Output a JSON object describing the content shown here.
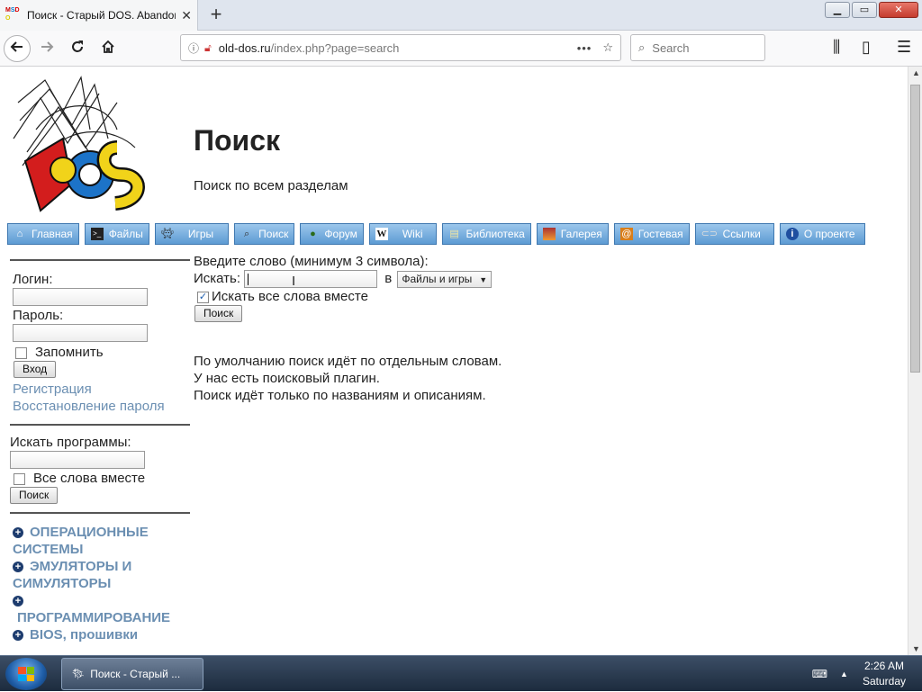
{
  "browser": {
    "tab_title": "Поиск - Старый DOS. Abandon",
    "new_tab": "+",
    "url_host": "old-dos.ru",
    "url_path": "/index.php?page=search",
    "search_placeholder": "Search",
    "window_controls": {
      "minimize": "▁",
      "maximize": "▭",
      "close": "✕"
    }
  },
  "page": {
    "title": "Поиск",
    "subtitle": "Поиск по всем разделам"
  },
  "menu": [
    {
      "label": "Главная",
      "icon": "home-icon"
    },
    {
      "label": "Файлы",
      "icon": "terminal-icon"
    },
    {
      "label": "Игры",
      "icon": "invader-icon"
    },
    {
      "label": "Поиск",
      "icon": "magnifier-icon"
    },
    {
      "label": "Форум",
      "icon": "person-icon"
    },
    {
      "label": "Wiki",
      "icon": "wiki-icon"
    },
    {
      "label": "Библиотека",
      "icon": "book-icon"
    },
    {
      "label": "Галерея",
      "icon": "picture-icon"
    },
    {
      "label": "Гостевая",
      "icon": "guestbook-icon"
    },
    {
      "label": "Ссылки",
      "icon": "link-icon"
    },
    {
      "label": "О проекте",
      "icon": "info-icon"
    }
  ],
  "login": {
    "login_label": "Логин:",
    "password_label": "Пароль:",
    "remember_label": "Запомнить",
    "submit_label": "Вход",
    "register_link": "Регистрация",
    "recover_link": "Восстановление пароля"
  },
  "side_search": {
    "label": "Искать программы:",
    "all_words_label": "Все слова вместе",
    "submit_label": "Поиск"
  },
  "categories": [
    "ОПЕРАЦИОННЫЕ СИСТЕМЫ",
    "ЭМУЛЯТОРЫ И СИМУЛЯТОРЫ",
    "ПРОГРАММИРОВАНИЕ",
    "BIOS, прошивки"
  ],
  "search_form": {
    "prompt": "Введите слово (минимум 3 символа):",
    "search_label": "Искать:",
    "in_label": "в",
    "scope_value": "Файлы и игры",
    "all_words_label": "Искать все слова вместе",
    "submit_label": "Поиск"
  },
  "notes": [
    "По умолчанию поиск идёт по отдельным словам.",
    "У нас есть поисковый плагин.",
    "Поиск идёт только по названиям и описаниям."
  ],
  "taskbar": {
    "item_label": "Поиск - Старый ...",
    "time": "2:26 AM",
    "day": "Saturday"
  }
}
